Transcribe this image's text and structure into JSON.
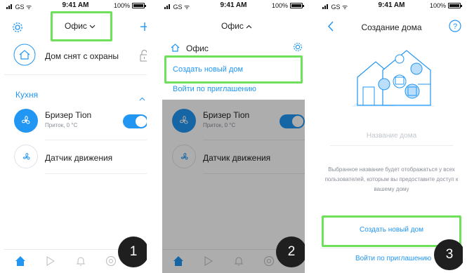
{
  "status": {
    "carrier": "GS",
    "time": "9:41 AM",
    "battery": "100%"
  },
  "screen1": {
    "home_selector": "Офис",
    "security_status": "Дом снят с охраны",
    "room_name": "Кухня",
    "breezer_name": "Бризер Tion",
    "breezer_status": "Приток, 0 °C",
    "motion_sensor": "Датчик движения",
    "step": "1"
  },
  "screen2": {
    "home_selector": "Офис",
    "current_home": "Офис",
    "create_home": "Создать новый дом",
    "join_invite": "Войти по приглашению",
    "breezer_name": "Бризер Tion",
    "breezer_status": "Приток, 0 °C",
    "motion_sensor": "Датчик движения",
    "step": "2"
  },
  "screen3": {
    "title": "Создание дома",
    "name_placeholder": "Название дома",
    "hint": "Выбранное название будет отображаться у всех пользователей, которым вы предоставите доступ к вашему дому",
    "create_button": "Создать новый дом",
    "join_invite": "Войти по приглашению",
    "step": "3"
  },
  "colors": {
    "accent": "#2196f3",
    "highlight": "#6ee05a",
    "badge": "#1f1f1f"
  },
  "icons": [
    "gear-icon",
    "plus-icon",
    "house-icon",
    "unlock-icon",
    "fan-icon",
    "chevron-up-icon",
    "motion-icon",
    "back-icon",
    "help-icon"
  ]
}
